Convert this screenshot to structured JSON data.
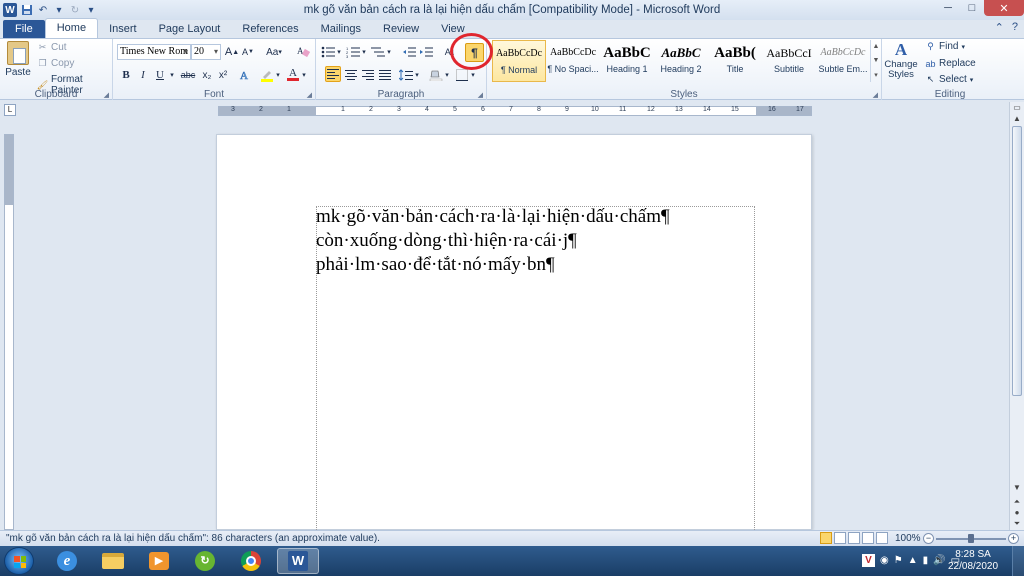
{
  "window": {
    "title": "mk gõ văn bản cách ra là lại hiện dấu chấm [Compatibility Mode]  -  Microsoft Word",
    "word_logo": "W",
    "controls": {
      "minimize": "─",
      "maximize": "□",
      "close": "✕"
    }
  },
  "tabs": [
    "File",
    "Home",
    "Insert",
    "Page Layout",
    "References",
    "Mailings",
    "Review",
    "View"
  ],
  "active_tab": "Home",
  "ribbon": {
    "clipboard": {
      "label": "Clipboard",
      "paste": "Paste",
      "cut": "Cut",
      "copy": "Copy",
      "format_painter": "Format Painter"
    },
    "font": {
      "label": "Font",
      "font_name": "Times New Rom",
      "font_size": "20",
      "grow": "A",
      "shrink": "A",
      "change_case": "Aa",
      "bold": "B",
      "italic": "I",
      "underline": "U",
      "strikethrough": "abc",
      "subscript": "x₂",
      "superscript": "x²",
      "font_color_letter": "A"
    },
    "paragraph": {
      "label": "Paragraph",
      "show_hide": "¶"
    },
    "styles": {
      "label": "Styles",
      "items": [
        {
          "preview": "AaBbCcDc",
          "name": "¶ Normal"
        },
        {
          "preview": "AaBbCcDc",
          "name": "¶ No Spaci..."
        },
        {
          "preview": "AaBbC",
          "name": "Heading 1"
        },
        {
          "preview": "AaBbC",
          "name": "Heading 2"
        },
        {
          "preview": "AaBb(",
          "name": "Title"
        },
        {
          "preview": "AaBbCcI",
          "name": "Subtitle"
        },
        {
          "preview": "AaBbCcDc",
          "name": "Subtle Em..."
        }
      ],
      "change_styles_icon": "A",
      "change_styles_line1": "Change",
      "change_styles_line2": "Styles"
    },
    "editing": {
      "label": "Editing",
      "find": "Find",
      "replace": "Replace",
      "select": "Select"
    }
  },
  "ruler": {
    "marks": [
      "3",
      "2",
      "1",
      "1",
      "2",
      "3",
      "4",
      "5",
      "6",
      "7",
      "8",
      "9",
      "10",
      "11",
      "12",
      "13",
      "14",
      "15",
      "16",
      "17"
    ]
  },
  "document": {
    "lines": [
      "mk·gõ·văn·bản·cách·ra·là·lại·hiện·dấu·chấm¶",
      "còn·xuống·dòng·thì·hiện·ra·cái·j¶",
      "phải·lm·sao·để·tắt·nó·mấy·bn¶"
    ]
  },
  "status": {
    "text": "\"mk gõ văn bản cách ra là lại hiện dấu chấm\": 86 characters (an approximate value).",
    "zoom": "100%"
  },
  "taskbar": {
    "clock_time": "8:28 SA",
    "clock_date": "22/08/2020"
  }
}
